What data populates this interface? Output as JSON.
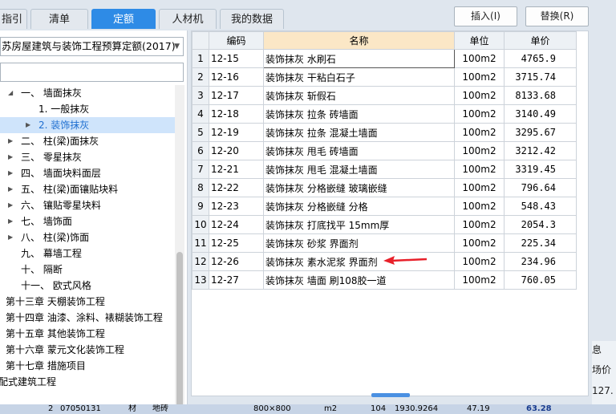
{
  "tabs": [
    {
      "label": "指引",
      "active": false
    },
    {
      "label": "清单",
      "active": false
    },
    {
      "label": "定额",
      "active": true
    },
    {
      "label": "人材机",
      "active": false
    },
    {
      "label": "我的数据",
      "active": false
    }
  ],
  "toolbar": {
    "insert_label": "插入(I)",
    "replace_label": "替换(R)"
  },
  "quota_library": {
    "value": "苏房屋建筑与装饰工程预算定额(2017)"
  },
  "search": {
    "value": ""
  },
  "tree": [
    {
      "label": "一、 墙面抹灰",
      "expanded": true
    },
    {
      "label": "1. 一般抹灰"
    },
    {
      "label": "2. 装饰抹灰",
      "selected": true
    },
    {
      "label": "二、 柱(梁)面抹灰"
    },
    {
      "label": "三、 零星抹灰"
    },
    {
      "label": "四、 墙面块料面层"
    },
    {
      "label": "五、 柱(梁)面镶贴块料"
    },
    {
      "label": "六、 镶贴零星块料"
    },
    {
      "label": "七、 墙饰面"
    },
    {
      "label": "八、 柱(梁)饰面"
    },
    {
      "label": "九、 幕墙工程"
    },
    {
      "label": "十、 隔断"
    },
    {
      "label": "十一、 欧式风格"
    },
    {
      "label": "第十三章 天棚装饰工程"
    },
    {
      "label": "第十四章 油漆、涂料、裱糊装饰工程"
    },
    {
      "label": "第十五章 其他装饰工程"
    },
    {
      "label": "第十六章 蒙元文化装饰工程"
    },
    {
      "label": "第十七章 措施项目"
    },
    {
      "label": "配式建筑工程"
    }
  ],
  "table": {
    "headers": {
      "code": "编码",
      "name": "名称",
      "unit": "单位",
      "price": "单价"
    },
    "rows": [
      {
        "no": "1",
        "code": "12-15",
        "name": "装饰抹灰 水刷石",
        "unit": "100m2",
        "price": "4765.9"
      },
      {
        "no": "2",
        "code": "12-16",
        "name": "装饰抹灰 干粘白石子",
        "unit": "100m2",
        "price": "3715.74"
      },
      {
        "no": "3",
        "code": "12-17",
        "name": "装饰抹灰 斩假石",
        "unit": "100m2",
        "price": "8133.68"
      },
      {
        "no": "4",
        "code": "12-18",
        "name": "装饰抹灰 拉条 砖墙面",
        "unit": "100m2",
        "price": "3140.49"
      },
      {
        "no": "5",
        "code": "12-19",
        "name": "装饰抹灰 拉条 混凝土墙面",
        "unit": "100m2",
        "price": "3295.67"
      },
      {
        "no": "6",
        "code": "12-20",
        "name": "装饰抹灰 甩毛 砖墙面",
        "unit": "100m2",
        "price": "3212.42"
      },
      {
        "no": "7",
        "code": "12-21",
        "name": "装饰抹灰 甩毛 混凝土墙面",
        "unit": "100m2",
        "price": "3319.45"
      },
      {
        "no": "8",
        "code": "12-22",
        "name": "装饰抹灰 分格嵌缝 玻璃嵌缝",
        "unit": "100m2",
        "price": "796.64"
      },
      {
        "no": "9",
        "code": "12-23",
        "name": "装饰抹灰 分格嵌缝 分格",
        "unit": "100m2",
        "price": "548.43"
      },
      {
        "no": "10",
        "code": "12-24",
        "name": "装饰抹灰 打底找平 15mm厚",
        "unit": "100m2",
        "price": "2054.3"
      },
      {
        "no": "11",
        "code": "12-25",
        "name": "装饰抹灰 砂浆 界面剂",
        "unit": "100m2",
        "price": "225.34"
      },
      {
        "no": "12",
        "code": "12-26",
        "name": "装饰抹灰 素水泥浆 界面剂",
        "unit": "100m2",
        "price": "234.96"
      },
      {
        "no": "13",
        "code": "12-27",
        "name": "装饰抹灰 墙面 刷108胶一道",
        "unit": "100m2",
        "price": "760.05"
      }
    ]
  },
  "right_edge": {
    "label1": "息",
    "label2": "场价",
    "label3": "127."
  },
  "bottom_row": {
    "row_no": "2",
    "code": "07050131",
    "type": "材",
    "name": "地砖",
    "spec": "800×800",
    "unit": "m2",
    "qty": "104",
    "total": "1930.9264",
    "price": "47.19",
    "amount": "63.28"
  },
  "colors": {
    "accent": "#2e8be6",
    "selection": "#cfe4fb",
    "header_highlight": "#fbe7c6",
    "arrow": "#e8202a"
  }
}
